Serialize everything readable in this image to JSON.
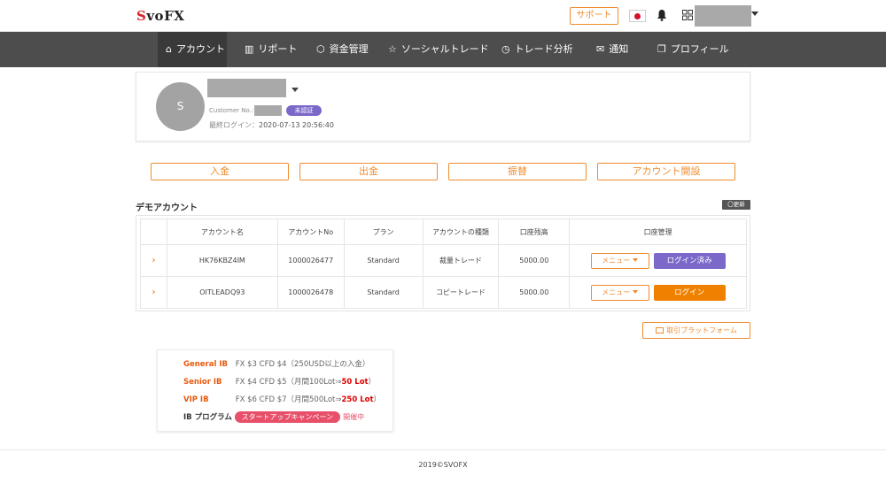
{
  "header": {
    "logo_prefix": "S",
    "logo_rest": "voFX",
    "support_label": "サポート",
    "flag_icon": "japan-flag-icon",
    "bell_icon": "bell-icon",
    "apps_icon": "grid-icon"
  },
  "nav": {
    "items": [
      {
        "icon": "home-icon",
        "glyph": "⌂",
        "label": "アカウント"
      },
      {
        "icon": "chart-icon",
        "glyph": "▥",
        "label": "リポート"
      },
      {
        "icon": "wallet-icon",
        "glyph": "⬡",
        "label": "資金管理"
      },
      {
        "icon": "star-icon",
        "glyph": "☆",
        "label": "ソーシャルトレード"
      },
      {
        "icon": "clock-icon",
        "glyph": "◷",
        "label": "トレード分析"
      },
      {
        "icon": "mail-icon",
        "glyph": "✉",
        "label": "通知"
      },
      {
        "icon": "document-icon",
        "glyph": "❐",
        "label": "プロフィール"
      }
    ]
  },
  "profile": {
    "avatar_letter": "S",
    "customer_no_label": "Customer No.:",
    "status_badge": "未認証",
    "last_login_label": "最終ログイン：",
    "last_login_value": "2020-07-13 20:56:40"
  },
  "actions": {
    "deposit": "入金",
    "withdraw": "出金",
    "transfer": "振替",
    "open_account": "アカウント開設"
  },
  "demo": {
    "title": "デモアカウント",
    "refresh": "〇更新",
    "columns": [
      "アカウント名",
      "アカウントNo",
      "プラン",
      "アカウントの種類",
      "口座残高",
      "口座管理"
    ],
    "rows": [
      {
        "name": "HK76KBZ4IM",
        "number": "1000026477",
        "plan": "Standard",
        "type": "裁量トレード",
        "balance": "5000.00",
        "menu": "メニュー",
        "login": "ログイン済み"
      },
      {
        "name": "OITLEADQ93",
        "number": "1000026478",
        "plan": "Standard",
        "type": "コピートレード",
        "balance": "5000.00",
        "menu": "メニュー",
        "login": "ログイン"
      }
    ]
  },
  "platform_label": "取引プラットフォーム",
  "ib": {
    "general_tier": "General IB",
    "general_text": "FX $3 CFD $4（250USD以上の入金）",
    "senior_tier": "Senior IB",
    "senior_text": "FX $4 CFD $5（月間100Lot⇒",
    "senior_hl": "50 Lot",
    "senior_end": "）",
    "vip_tier": "VIP IB",
    "vip_text": "FX $6 CFD $7（月間500Lot⇒",
    "vip_hl": "250 Lot",
    "vip_end": "）",
    "program_label": "IB プログラム",
    "campaign_label": "スタートアップキャンペーン",
    "ongoing_label": "開催中"
  },
  "footer": "2019©SVOFX"
}
